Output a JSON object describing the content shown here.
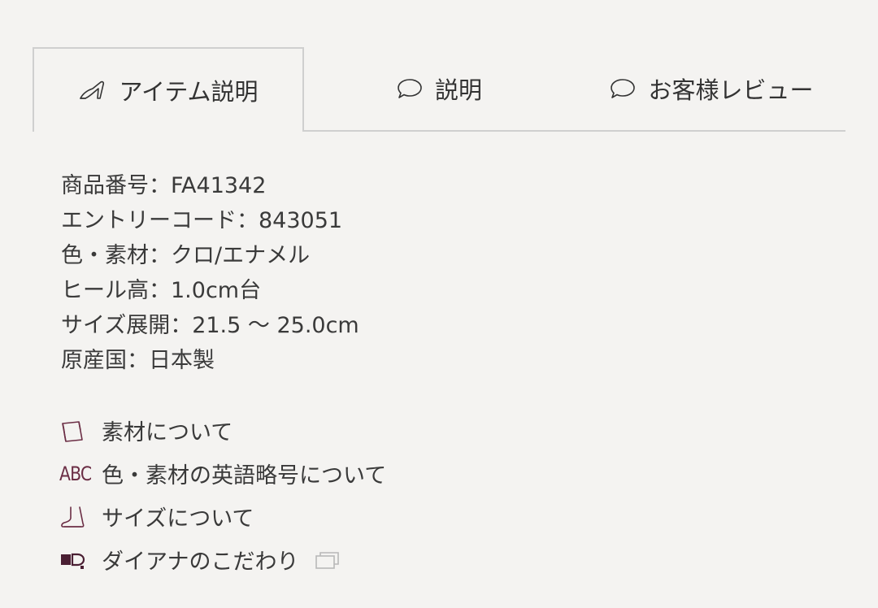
{
  "tabs": [
    {
      "label": "アイテム説明",
      "icon": "heel-shoe-icon",
      "active": true
    },
    {
      "label": "説明",
      "icon": "speech-bubble-icon",
      "active": false
    },
    {
      "label": "お客様レビュー",
      "icon": "speech-bubble-icon",
      "active": false
    }
  ],
  "specs": [
    "商品番号：FA41342",
    "エントリーコード：843051",
    "色・素材：クロ/エナメル",
    "ヒール高：1.0cm台",
    "サイズ展開：21.5 〜 25.0cm",
    "原産国：日本製"
  ],
  "links": [
    {
      "label": "素材について",
      "icon": "fabric-icon"
    },
    {
      "label": "色・素材の英語略号について",
      "icon": "abc-icon",
      "icon_text": "ABC"
    },
    {
      "label": "サイズについて",
      "icon": "foot-icon"
    },
    {
      "label": "ダイアナのこだわり",
      "icon": "diana-logo-icon",
      "external_icon": "external-window-icon"
    }
  ],
  "colors": {
    "background": "#f4f3f1",
    "accent": "#6b2e45",
    "border": "#cfcfcf",
    "text": "#3a3a3a"
  }
}
